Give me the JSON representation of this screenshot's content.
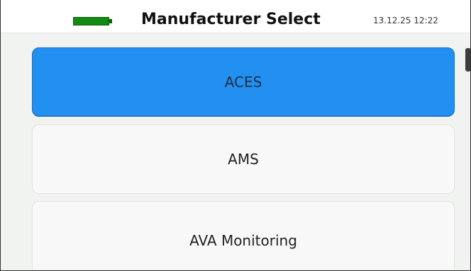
{
  "header": {
    "title": "Manufacturer Select",
    "datetime": "13.12.25 12:22",
    "battery_icon": "battery-icon"
  },
  "manufacturers": {
    "items": [
      {
        "label": "ACES",
        "selected": true
      },
      {
        "label": "AMS",
        "selected": false
      },
      {
        "label": "AVA Monitoring",
        "selected": false
      }
    ]
  },
  "scrollbar": {
    "visible": true
  },
  "colors": {
    "selected": "#2290f0",
    "item_background": "#f7f8f7",
    "battery": "#138b12",
    "screen_background": "#f1f3f1"
  }
}
